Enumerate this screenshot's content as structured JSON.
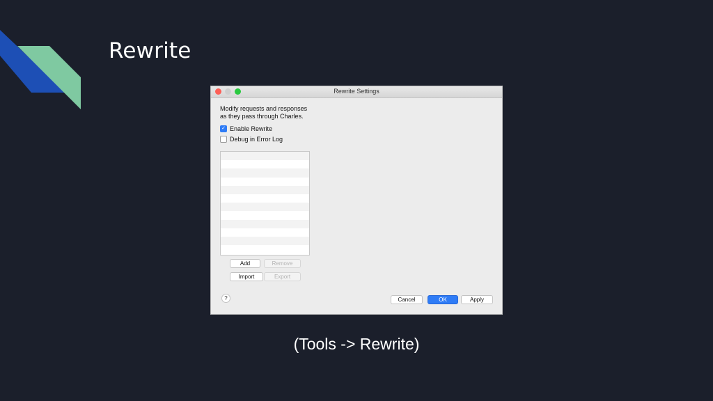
{
  "slide": {
    "title": "Rewrite",
    "caption": "(Tools -> Rewrite)",
    "accent_colors": [
      "#1d4fb5",
      "#7fc9a1"
    ]
  },
  "window": {
    "title": "Rewrite Settings",
    "description_line1": "Modify requests and responses",
    "description_line2": "as they pass through Charles.",
    "enable_rewrite": {
      "label": "Enable Rewrite",
      "checked": true
    },
    "debug_log": {
      "label": "Debug in Error Log",
      "checked": false
    },
    "list_rows": 12,
    "buttons": {
      "add": "Add",
      "remove": "Remove",
      "import": "Import",
      "export": "Export",
      "help": "?",
      "cancel": "Cancel",
      "ok": "OK",
      "apply": "Apply"
    }
  }
}
